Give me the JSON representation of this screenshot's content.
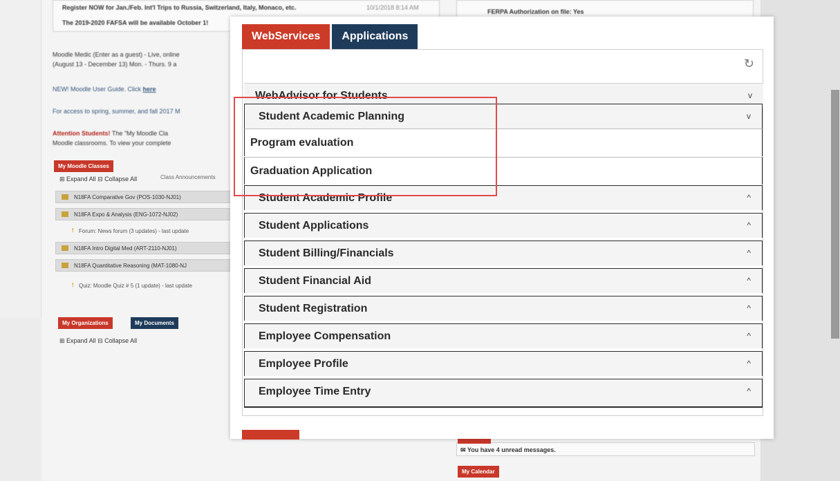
{
  "background": {
    "notice1": "Register NOW for Jan./Feb. Int'l Trips to Russia, Switzerland, Italy, Monaco, etc.",
    "notice1_date": "10/1/2018 8:14 AM",
    "notice2": "The 2019-2020 FAFSA will be available October 1!",
    "ferpa": "FERPA Authorization on file: Yes",
    "moodle_medic": "Moodle Medic (Enter as a guest) - Live, online",
    "moodle_medic2": "(August 13 - December 13) Mon. - Thurs. 9 a",
    "user_guide": "NEW! Moodle User Guide. Click ",
    "user_guide_link": "here",
    "access_note": "For access to spring, summer, and fall 2017 M",
    "attention_label": "Attention Students!",
    "attention_text": " The \"My Moodle Cla",
    "attention_text2": "Moodle classrooms. To view your complete",
    "my_moodle_classes": "My Moodle Classes",
    "expand_collapse": "⊞ Expand All ⊟ Collapse All",
    "class_announcements": "Class Announcements",
    "courses": [
      "N18FA Comparative Gov (POS-1030-NJ01)",
      "N18FA Expo & Analysis (ENG-1072-NJ02)",
      "N18FA Intro Digital Med (ART-2110-NJ01)",
      "N18FA Quantitative Reasoning (MAT-1080-NJ"
    ],
    "forum_update": "Forum: News forum (3 updates) - last update",
    "quiz_update": "Quiz: Moodle Quiz # 5 (1 update) - last update",
    "my_organizations": "My Organizations",
    "my_documents": "My Documents",
    "expand_collapse2": "⊞ Expand All ⊟ Collapse All",
    "unread_messages": "You have 4 unread messages.",
    "my_calendar": "My Calendar"
  },
  "modal": {
    "tabs": [
      {
        "label": "WebServices",
        "active": true
      },
      {
        "label": "Applications",
        "active": false
      }
    ],
    "refresh_icon": "↻",
    "sections_top": {
      "label": "WebAdvisor for Students",
      "chevron": "v"
    },
    "open_group": {
      "label": "Student Academic Planning",
      "chevron": "v",
      "items": [
        "Program evaluation",
        "Graduation Application"
      ]
    },
    "sections": [
      {
        "label": "Student Academic Profile",
        "chevron": "^"
      },
      {
        "label": "Student Applications",
        "chevron": "^"
      },
      {
        "label": "Student Billing/Financials",
        "chevron": "^"
      },
      {
        "label": "Student Financial Aid",
        "chevron": "^"
      },
      {
        "label": "Student Registration",
        "chevron": "^"
      },
      {
        "label": "Employee Compensation",
        "chevron": "^"
      },
      {
        "label": "Employee Profile",
        "chevron": "^"
      },
      {
        "label": "Employee Time Entry",
        "chevron": "^"
      }
    ]
  },
  "colors": {
    "accent_red": "#cc3a28",
    "navy": "#1f3b5b",
    "highlight": "#e24a4a"
  }
}
